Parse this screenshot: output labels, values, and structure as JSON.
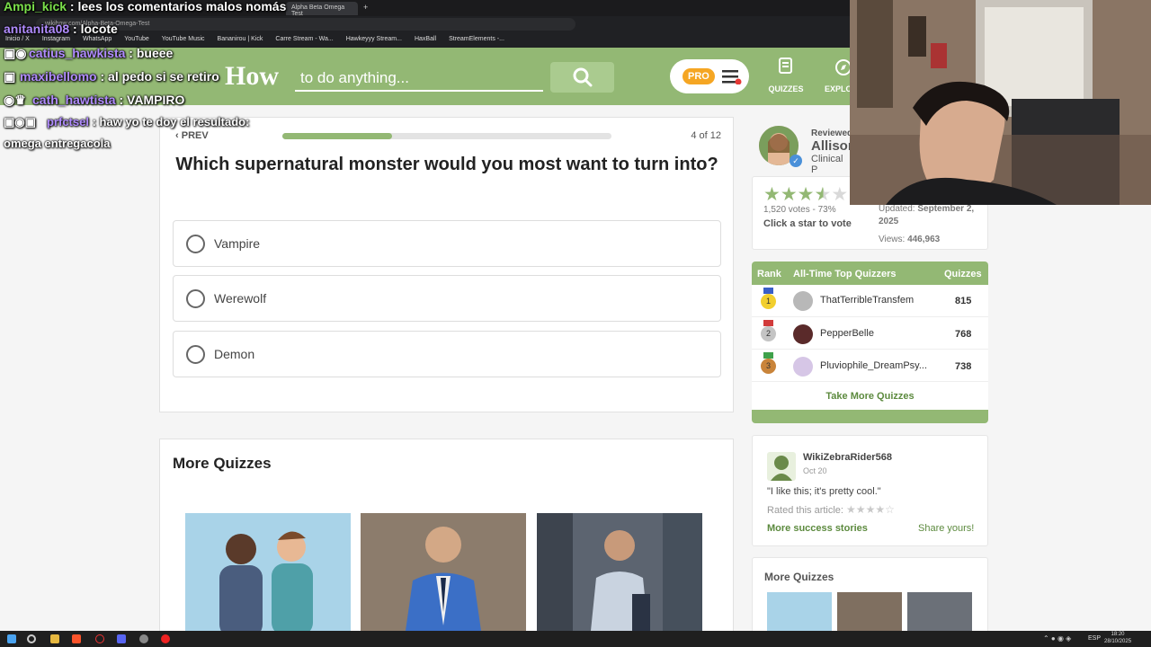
{
  "browser": {
    "tabs": [
      "Alpha Beta Omega Test"
    ],
    "url": "wikihow.com/Alpha-Beta-Omega-Test",
    "bookmarks": [
      "Inicio / X",
      "Instagram",
      "WhatsApp",
      "YouTube",
      "YouTube Music",
      "Bananirou | Kick",
      "Carre Stream - Wa...",
      "Hawkeyyy Stream...",
      "HaxBall",
      "StreamElements -..."
    ]
  },
  "header": {
    "logo": "How",
    "search_placeholder": "to do anything...",
    "pro_label": "PRO",
    "nav": [
      {
        "label": "QUIZZES"
      },
      {
        "label": "EXPLO"
      }
    ],
    "colors": {
      "brand": "#93b874",
      "pro": "#f5a623"
    }
  },
  "quiz": {
    "prev": "PREV",
    "progress_label": "4 of 12",
    "progress": 0.333,
    "question": "Which supernatural monster would you most want to turn into?",
    "options": [
      "Vampire",
      "Werewolf",
      "Demon"
    ]
  },
  "more_quizzes": {
    "title": "More Quizzes",
    "thumbs": [
      "cartoon-two-men",
      "man-blue-suit",
      "man-street"
    ]
  },
  "sidebar": {
    "reviewer": {
      "reviewed": "Reviewed",
      "name": "Allison",
      "title": "Clinical P"
    },
    "rating": {
      "stars": 3.5,
      "votes": "1,520 votes - 73%",
      "cta": "Click a star to vote"
    },
    "updated_label": "Updated:",
    "updated_date": "September 2,",
    "updated_year": "2025",
    "views_label": "Views:",
    "views": "446,963",
    "leaderboard": {
      "headers": [
        "Rank",
        "All-Time Top Quizzers",
        "Quizzes"
      ],
      "rows": [
        {
          "rank": "1",
          "name": "ThatTerribleTransfem",
          "score": "815"
        },
        {
          "rank": "2",
          "name": "PepperBelle",
          "score": "768"
        },
        {
          "rank": "3",
          "name": "Pluviophile_DreamPsy...",
          "score": "738"
        }
      ],
      "cta": "Take More Quizzes"
    },
    "story": {
      "user": "WikiZebraRider568",
      "date": "Oct 20",
      "quote": "\"I like this; it's pretty cool.\"",
      "rated": "Rated this article:",
      "more": "More success stories",
      "share": "Share yours!"
    },
    "more_quizzes": "More Quizzes"
  },
  "chat": [
    {
      "user": "Ampi_kick",
      "color": "#7be04b",
      "msg": "lees los comentarios malos nomás"
    },
    {
      "user": "anitanita08",
      "color": "#b18cff",
      "msg": "locote"
    },
    {
      "user": "catius_hawkista",
      "color": "#b18cff",
      "msg": "bueee"
    },
    {
      "user": "maxibellomo",
      "color": "#b18cff",
      "msg": "al pedo si se retiro"
    },
    {
      "user": "cath_hawtista",
      "color": "#b18cff",
      "msg": "VAMPIRO"
    },
    {
      "user": "prfctsel",
      "color": "#b18cff",
      "msg": "haw yo te doy el resultado:"
    },
    {
      "user": "",
      "color": "#ffffff",
      "msg": "omega entregacola"
    }
  ],
  "taskbar": {
    "lang": "ESP",
    "time": "18:20",
    "date": "28/10/2025"
  }
}
